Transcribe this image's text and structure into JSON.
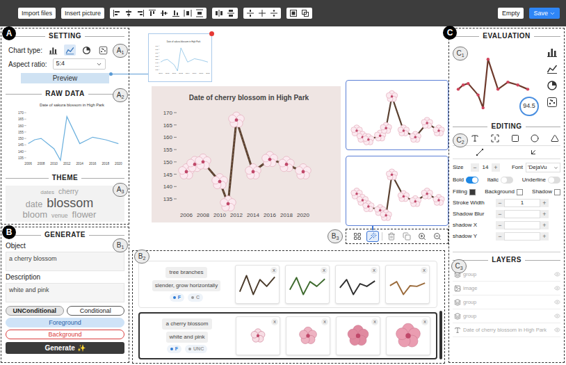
{
  "toolbar": {
    "left_buttons": [
      "Import files",
      "Insert picture"
    ],
    "right_buttons": [
      {
        "label": "Empty",
        "primary": false
      },
      {
        "label": "Save",
        "primary": true
      }
    ]
  },
  "panel_a": {
    "marker": "A",
    "setting": {
      "marker": [
        "A",
        "1"
      ],
      "title": "SETTING",
      "chart_type_label": "Chart type:",
      "chart_types": [
        {
          "kind": "bar",
          "selected": false
        },
        {
          "kind": "line",
          "selected": true
        },
        {
          "kind": "pie",
          "selected": false
        },
        {
          "kind": "scatter",
          "selected": false
        }
      ],
      "aspect_label": "Aspect ratio:",
      "aspect_value": "5:4",
      "preview_button": "Preview"
    },
    "raw_data": {
      "marker": [
        "A",
        "2"
      ],
      "title": "RAW DATA",
      "chart": {
        "title": "Date of sakura blossom in High Park",
        "y_ticks": [
          "170",
          "165",
          "160",
          "155",
          "150",
          "145",
          "140",
          "135"
        ],
        "x_ticks": [
          "2006",
          "2008",
          "2010",
          "2012",
          "2014",
          "2016",
          "2018",
          "2020"
        ],
        "x": [
          2006,
          2007,
          2008,
          2010,
          2011,
          2012,
          2014,
          2016,
          2018,
          2020
        ],
        "values": [
          146,
          149,
          150,
          142,
          133,
          167,
          146,
          151,
          149,
          146
        ]
      }
    },
    "theme": {
      "marker": [
        "A",
        "3"
      ],
      "title": "THEME",
      "rows": [
        [
          {
            "text": "dates",
            "level": 0.1
          },
          {
            "text": "cherry",
            "level": 0.3
          }
        ],
        [
          {
            "text": "date",
            "level": 0.5
          },
          {
            "text": "blossom",
            "level": 1
          }
        ],
        [
          {
            "text": "bloom",
            "level": 0.55
          },
          {
            "text": "venue",
            "level": 0.15
          },
          {
            "text": "flower",
            "level": 0.55
          }
        ]
      ]
    }
  },
  "panel_b": {
    "marker": "B",
    "generate": {
      "marker": [
        "B",
        "1"
      ],
      "title": "GENERATE",
      "object_label": "Object",
      "object_value": "a cherry blossom",
      "description_label": "Description",
      "description_value": "white and pink",
      "modes": [
        {
          "label": "UNConditional",
          "selected": true
        },
        {
          "label": "Conditional",
          "selected": false
        }
      ],
      "layers": [
        {
          "label": "Foreground",
          "selected": true,
          "color": "#1f5fa8"
        },
        {
          "label": "Background",
          "selected": false,
          "color": "#d93b3b"
        }
      ],
      "generate_button": "Generate ✨"
    }
  },
  "canvas": {
    "chart": {
      "title": "Date of cherry blossom in High Park",
      "y_ticks": [
        "170",
        "165",
        "160",
        "155",
        "150",
        "145",
        "140",
        "135"
      ],
      "x_ticks": [
        "2006",
        "2008",
        "2010",
        "2012",
        "2014",
        "2016",
        "2018",
        "2020"
      ],
      "x": [
        2006,
        2007,
        2008,
        2010,
        2011,
        2012,
        2014,
        2016,
        2018,
        2020
      ],
      "values": [
        146,
        149,
        150,
        142,
        133,
        167,
        146,
        151,
        149,
        146
      ]
    },
    "candidates": [
      {
        "values": [
          141,
          136,
          134,
          137,
          143,
          168,
          141,
          136,
          147,
          141
        ]
      },
      {
        "values": [
          151,
          146,
          141,
          138,
          134,
          166,
          149,
          145,
          151,
          146
        ]
      }
    ],
    "tools": {
      "marker": [
        "B",
        "3"
      ],
      "items": [
        {
          "kind": "grid",
          "selected": false
        },
        {
          "kind": "wand",
          "selected": true
        },
        {
          "kind": "trash",
          "selected": false
        },
        {
          "kind": "copy",
          "selected": false
        },
        {
          "kind": "zoom-in",
          "selected": false
        },
        {
          "kind": "zoom-out",
          "selected": false
        }
      ]
    }
  },
  "results": {
    "marker": [
      "B",
      "2"
    ],
    "close_label": "X",
    "rows": [
      {
        "object": "tree branches",
        "description": "slender, grow horizontally",
        "selected": false,
        "tags": [
          {
            "label": "F",
            "color": "#2b7bd6"
          },
          {
            "label": "C",
            "color": "#9a9a9a"
          }
        ],
        "images": [
          {
            "kind": "branch",
            "color": "#4a3a2a"
          },
          {
            "kind": "branch",
            "color": "#3f6b2f"
          },
          {
            "kind": "branch",
            "color": "#2e2e2e"
          },
          {
            "kind": "branch",
            "color": "#9a6a3a"
          }
        ]
      },
      {
        "object": "a cherry blossom",
        "description": "white and pink",
        "selected": true,
        "tags": [
          {
            "label": "F",
            "color": "#2b7bd6"
          },
          {
            "label": "UNC",
            "color": "#9a9a9a"
          }
        ],
        "images": [
          {
            "kind": "flower",
            "color": "#f7dde4"
          },
          {
            "kind": "flower",
            "color": "#eeb3c2"
          },
          {
            "kind": "flower",
            "color": "#e08aa0"
          },
          {
            "kind": "flower",
            "color": "#ea9db1"
          }
        ]
      }
    ]
  },
  "panel_c": {
    "marker": "C",
    "evaluation": {
      "marker": [
        "C",
        "1"
      ],
      "title": "EVALUATION",
      "score": "94.5",
      "values": [
        146,
        149,
        150,
        142,
        133,
        167,
        146,
        151,
        149,
        146
      ],
      "chart_types": [
        {
          "kind": "bar"
        },
        {
          "kind": "line"
        },
        {
          "kind": "pie"
        },
        {
          "kind": "scatter"
        }
      ]
    },
    "editing": {
      "marker": [
        "C",
        "2"
      ],
      "title": "EDITING",
      "tools": [
        {
          "kind": "text"
        },
        {
          "kind": "textbox"
        },
        {
          "kind": "rect"
        },
        {
          "kind": "circle"
        },
        {
          "kind": "triangle"
        }
      ],
      "line_tools": [
        {
          "kind": "line"
        },
        {
          "kind": "arrow"
        }
      ],
      "minus": "−",
      "plus": "+",
      "size_label": "Size",
      "size_value": "14",
      "font_label": "Font",
      "font_value": "'DejaVu",
      "toggles": [
        {
          "label": "Bold",
          "on": true
        },
        {
          "label": "Italic",
          "on": false
        },
        {
          "label": "Underline",
          "on": false
        }
      ],
      "swatches": [
        {
          "label": "Filling",
          "color": "#3a3a3a"
        },
        {
          "label": "Background",
          "color": "#ffffff"
        },
        {
          "label": "Shadow",
          "color": "#ffffff"
        }
      ],
      "steppers": [
        {
          "label": "Stroke Width",
          "value": "1"
        },
        {
          "label": "Shadow Blur",
          "value": ""
        },
        {
          "label": "shadow X",
          "value": ""
        },
        {
          "label": "shadow Y",
          "value": ""
        }
      ]
    },
    "layers": {
      "marker": [
        "C",
        "3"
      ],
      "title": "LAYERS",
      "items": [
        {
          "kind": "group",
          "label": "group"
        },
        {
          "kind": "image",
          "label": "image"
        },
        {
          "kind": "group",
          "label": "group"
        },
        {
          "kind": "group",
          "label": "group"
        },
        {
          "kind": "text",
          "label": "Date of cherry blossom in High Park"
        }
      ]
    }
  }
}
